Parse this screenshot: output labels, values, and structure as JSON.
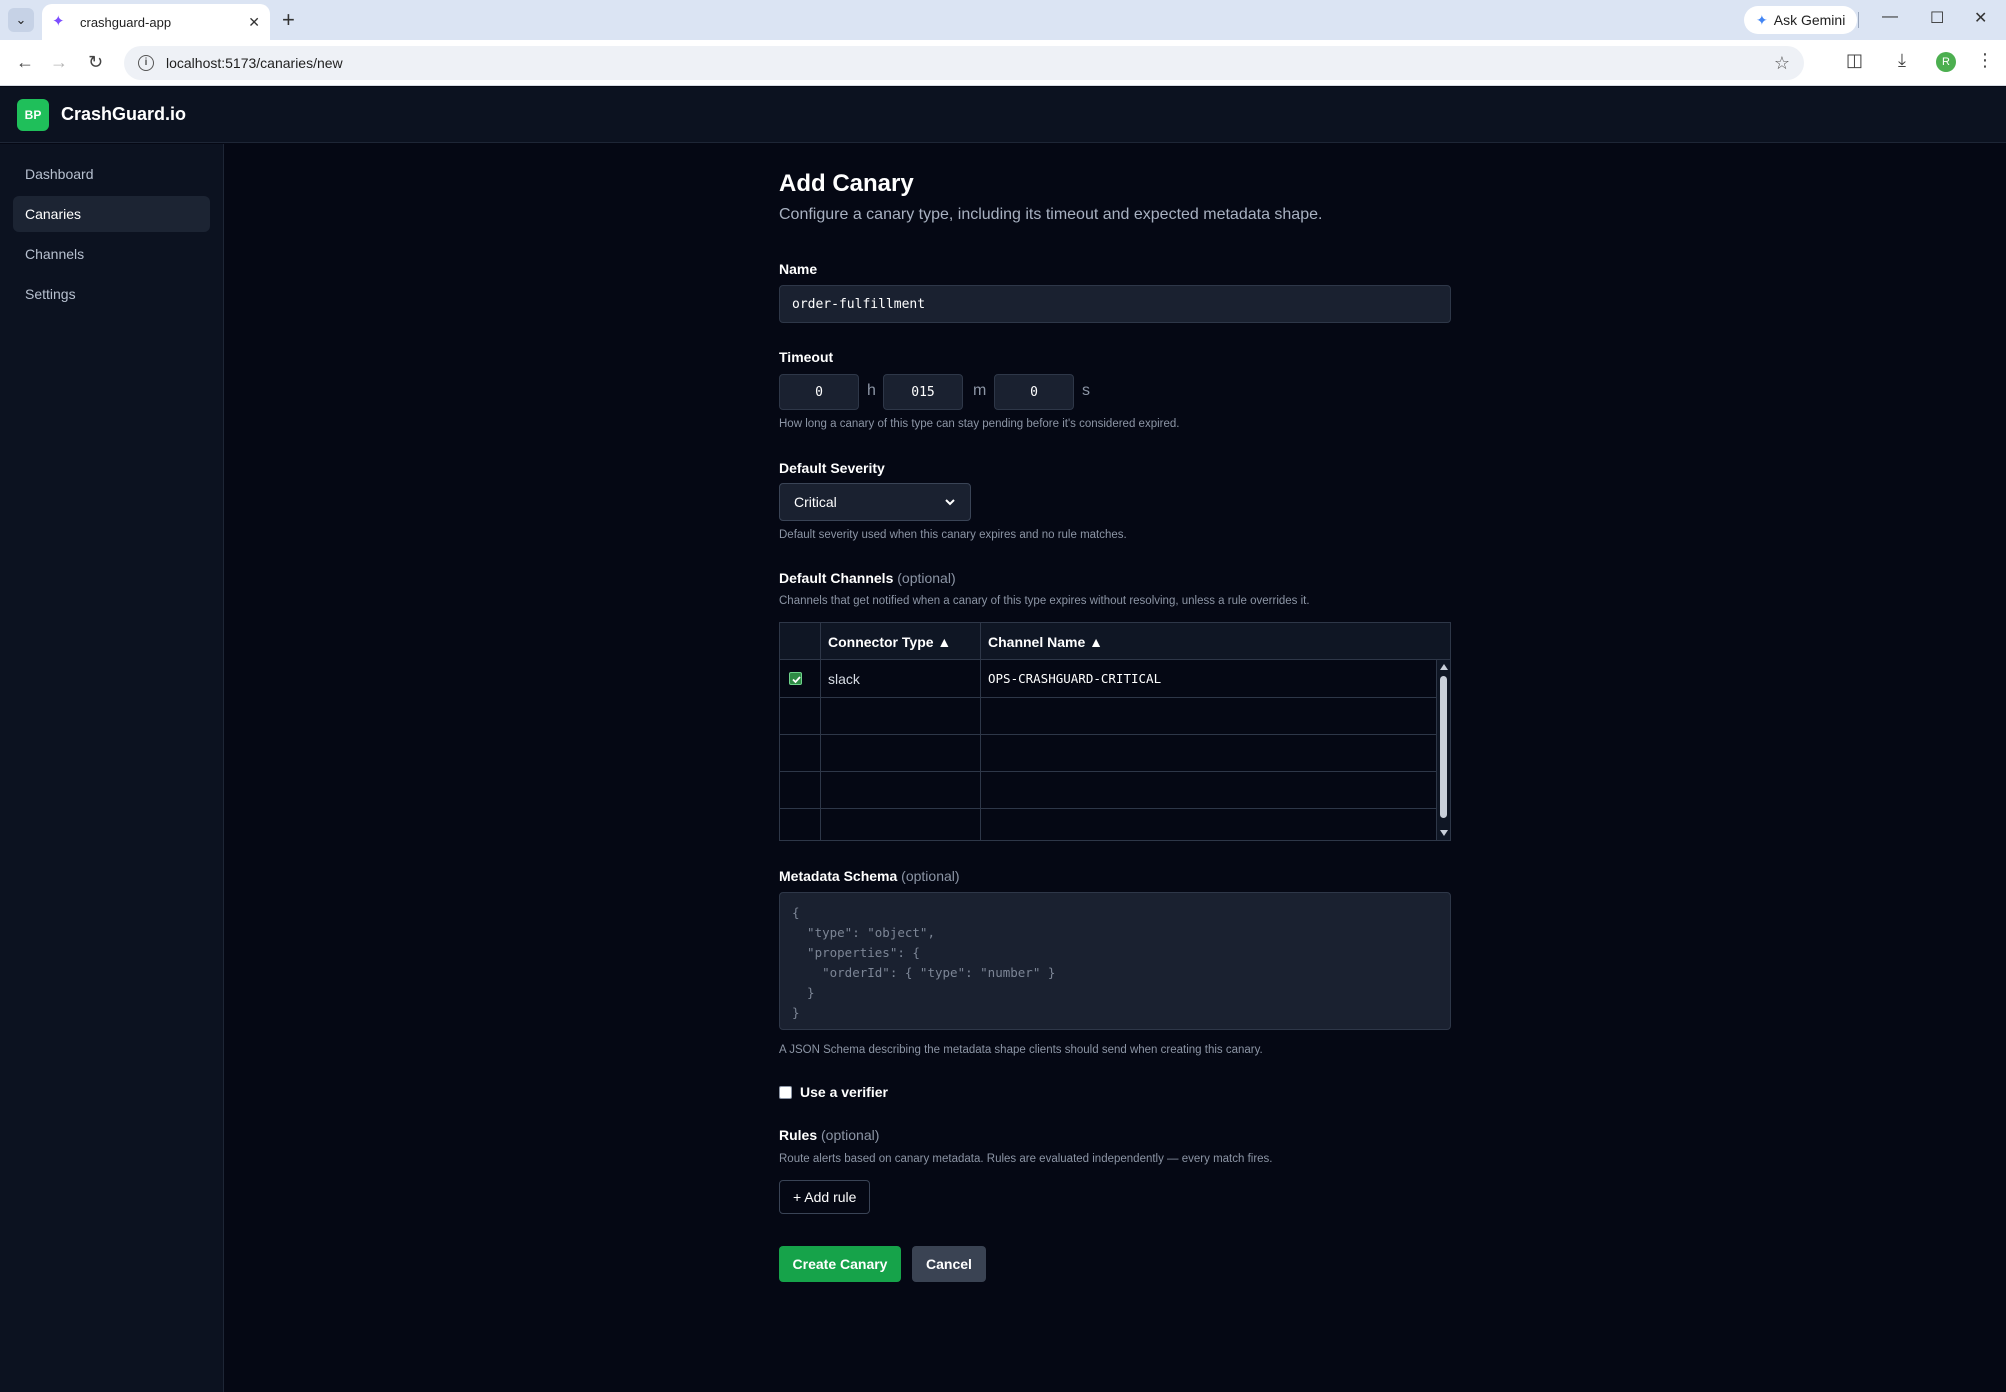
{
  "browser": {
    "tab_title": "crashguard-app",
    "url": "localhost:5173/canaries/new",
    "gemini_label": "Ask Gemini",
    "profile_initial": "R"
  },
  "app": {
    "logo_text": "BP",
    "brand": "CrashGuard.io"
  },
  "sidebar": {
    "items": [
      {
        "label": "Dashboard"
      },
      {
        "label": "Canaries"
      },
      {
        "label": "Channels"
      },
      {
        "label": "Settings"
      }
    ],
    "active": "Canaries"
  },
  "form": {
    "title": "Add Canary",
    "subtitle": "Configure a canary type, including its timeout and expected metadata shape.",
    "name": {
      "label": "Name",
      "value": "order-fulfillment"
    },
    "timeout": {
      "label": "Timeout",
      "hours": "0",
      "hours_unit": "h",
      "minutes": "015",
      "minutes_unit": "m",
      "seconds": "0",
      "seconds_unit": "s",
      "hint": "How long a canary of this type can stay pending before it's considered expired."
    },
    "severity": {
      "label": "Default Severity",
      "value": "Critical",
      "hint": "Default severity used when this canary expires and no rule matches."
    },
    "channels": {
      "label": "Default Channels",
      "optional": "(optional)",
      "hint": "Channels that get notified when a canary of this type expires without resolving, unless a rule overrides it.",
      "columns": [
        "Connector Type ▲",
        "Channel Name ▲"
      ],
      "rows": [
        {
          "checked": true,
          "connector": "slack",
          "channel": "OPS-CRASHGUARD-CRITICAL"
        }
      ]
    },
    "metadata": {
      "label": "Metadata Schema",
      "optional": "(optional)",
      "placeholder": "{\n  \"type\": \"object\",\n  \"properties\": {\n    \"orderId\": { \"type\": \"number\" }\n  }\n}",
      "hint": "A JSON Schema describing the metadata shape clients should send when creating this canary."
    },
    "verifier": {
      "label": "Use a verifier",
      "checked": false
    },
    "rules": {
      "label": "Rules",
      "optional": "(optional)",
      "hint": "Route alerts based on canary metadata. Rules are evaluated independently — every match fires.",
      "add_label": "+ Add rule"
    },
    "actions": {
      "create": "Create Canary",
      "cancel": "Cancel"
    }
  },
  "colors": {
    "accent": "#16a34a",
    "background": "#050814",
    "panel": "#0c1220",
    "input": "#1a2130"
  }
}
